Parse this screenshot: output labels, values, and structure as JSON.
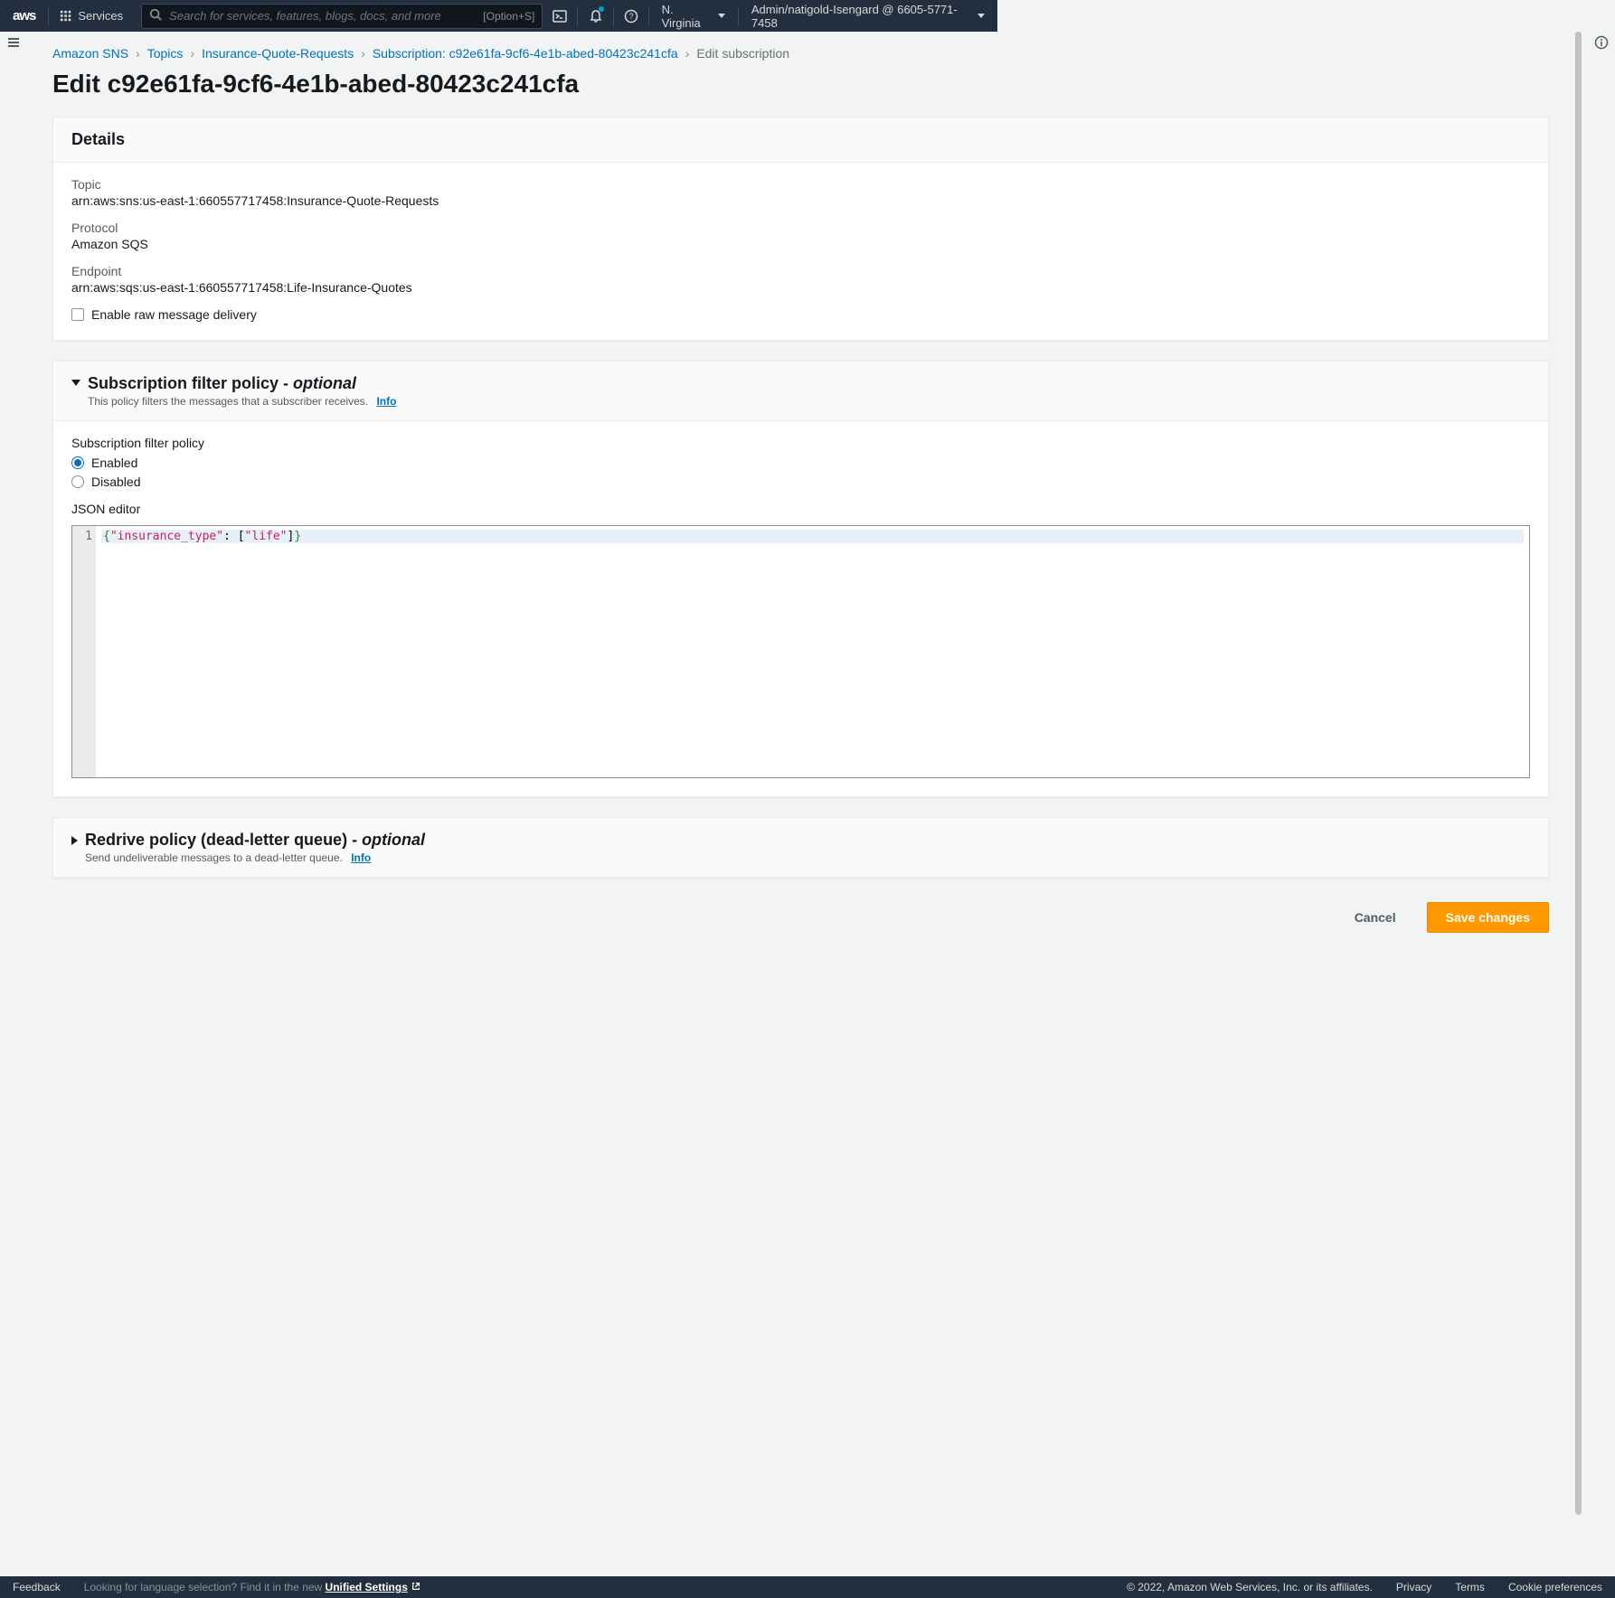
{
  "header": {
    "logo": "aws",
    "services": "Services",
    "search_placeholder": "Search for services, features, blogs, docs, and more",
    "search_shortcut": "[Option+S]",
    "region": "N. Virginia",
    "user": "Admin/natigold-Isengard @ 6605-5771-7458"
  },
  "breadcrumb": {
    "items": [
      {
        "label": "Amazon SNS",
        "link": true
      },
      {
        "label": "Topics",
        "link": true
      },
      {
        "label": "Insurance-Quote-Requests",
        "link": true
      },
      {
        "label": "Subscription: c92e61fa-9cf6-4e1b-abed-80423c241cfa",
        "link": true
      },
      {
        "label": "Edit subscription",
        "link": false
      }
    ]
  },
  "page_title": "Edit c92e61fa-9cf6-4e1b-abed-80423c241cfa",
  "details": {
    "heading": "Details",
    "topic_label": "Topic",
    "topic_value": "arn:aws:sns:us-east-1:660557717458:Insurance-Quote-Requests",
    "protocol_label": "Protocol",
    "protocol_value": "Amazon SQS",
    "endpoint_label": "Endpoint",
    "endpoint_value": "arn:aws:sqs:us-east-1:660557717458:Life-Insurance-Quotes",
    "raw_delivery_label": "Enable raw message delivery"
  },
  "filter_policy": {
    "title": "Subscription filter policy - ",
    "optional": "optional",
    "desc": "This policy filters the messages that a subscriber receives.",
    "info": "Info",
    "field_label": "Subscription filter policy",
    "enabled": "Enabled",
    "disabled": "Disabled",
    "editor_label": "JSON editor",
    "json_line_no": "1",
    "json_tokens": {
      "open": "{",
      "key": "\"insurance_type\"",
      "colon": ": ",
      "lbracket": "[",
      "val": "\"life\"",
      "rbracket": "]",
      "close": "}"
    }
  },
  "redrive": {
    "title": "Redrive policy (dead-letter queue) - ",
    "optional": "optional",
    "desc": "Send undeliverable messages to a dead-letter queue.",
    "info": "Info"
  },
  "actions": {
    "cancel": "Cancel",
    "save": "Save changes"
  },
  "footer": {
    "feedback": "Feedback",
    "lang_prompt": "Looking for language selection? Find it in the new ",
    "unified": "Unified Settings",
    "copyright": "© 2022, Amazon Web Services, Inc. or its affiliates.",
    "privacy": "Privacy",
    "terms": "Terms",
    "cookie": "Cookie preferences"
  }
}
